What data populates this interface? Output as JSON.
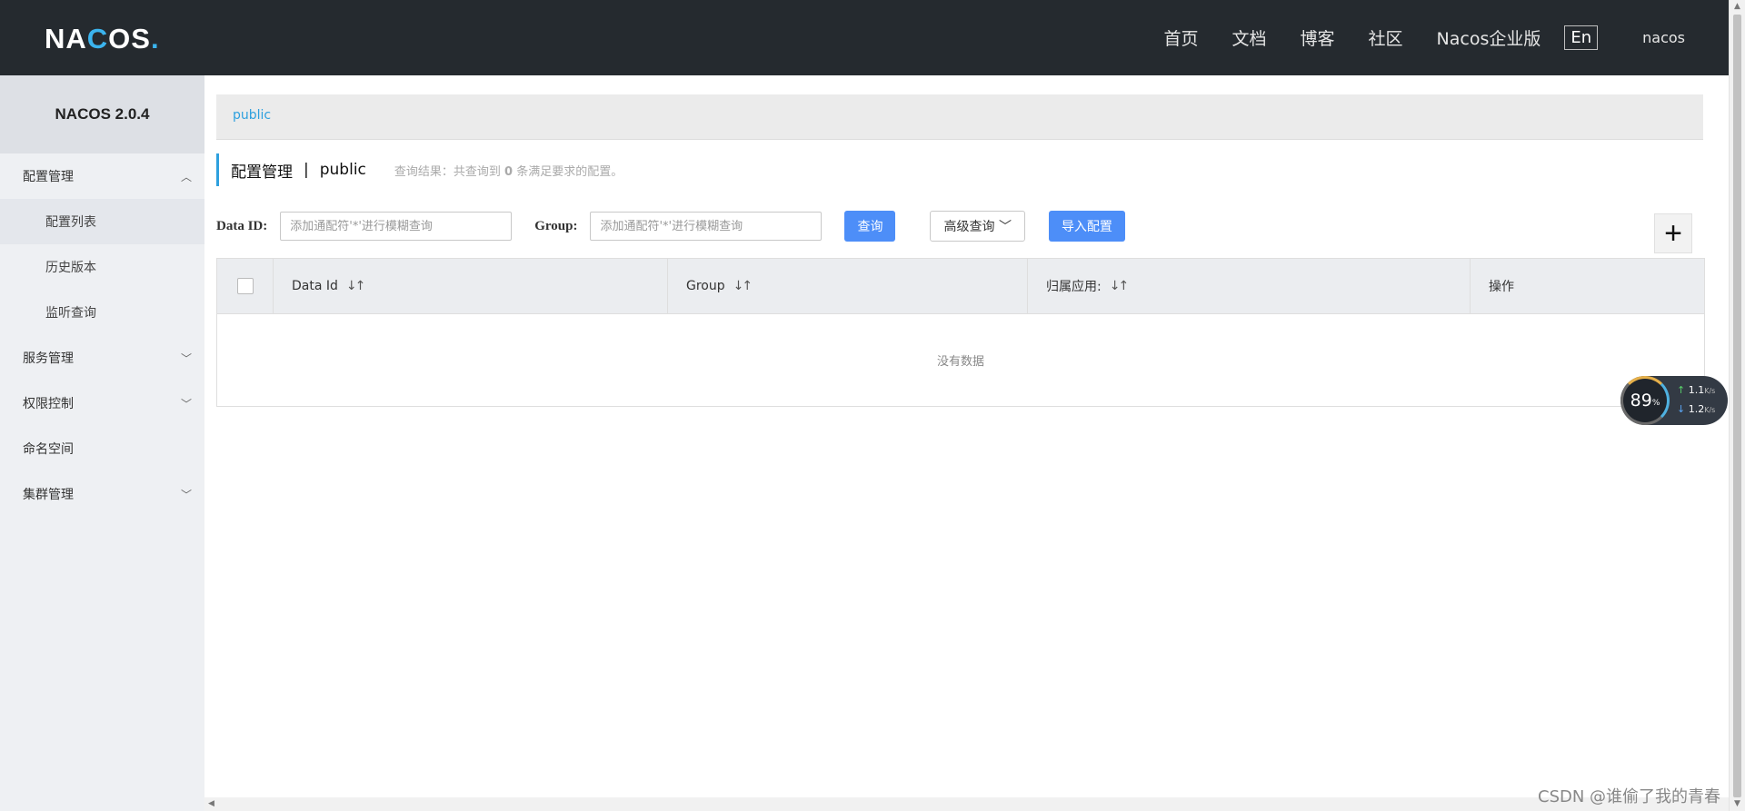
{
  "header": {
    "logo_text": "NACOS.",
    "nav": [
      "首页",
      "文档",
      "博客",
      "社区",
      "Nacos企业版"
    ],
    "lang_button": "En",
    "user": "nacos"
  },
  "sidebar": {
    "version": "NACOS 2.0.4",
    "menu": [
      {
        "label": "配置管理",
        "expanded": true
      },
      {
        "label": "配置列表",
        "sub": true
      },
      {
        "label": "历史版本",
        "sub": true
      },
      {
        "label": "监听查询",
        "sub": true
      },
      {
        "label": "服务管理",
        "expanded": false
      },
      {
        "label": "权限控制",
        "expanded": false
      },
      {
        "label": "命名空间"
      },
      {
        "label": "集群管理",
        "expanded": false
      }
    ]
  },
  "main": {
    "breadcrumb": "public",
    "page_title": "配置管理",
    "separator": "|",
    "namespace": "public",
    "result_prefix": "查询结果：共查询到",
    "result_count": "0",
    "result_suffix": "条满足要求的配置。",
    "data_id_label": "Data ID:",
    "data_id_placeholder": "添加通配符'*'进行模糊查询",
    "group_label": "Group:",
    "group_placeholder": "添加通配符'*'进行模糊查询",
    "query_button": "查询",
    "advanced_button": "高级查询",
    "import_button": "导入配置",
    "add_button": "+",
    "table": {
      "headers": [
        "Data Id",
        "Group",
        "归属应用:",
        "操作"
      ],
      "empty_text": "没有数据"
    }
  },
  "widget": {
    "percent": "89",
    "percent_unit": "%",
    "up": "1.1",
    "down": "1.2",
    "rate_unit": "K/s"
  },
  "watermark": "CSDN @谁偷了我的青春"
}
